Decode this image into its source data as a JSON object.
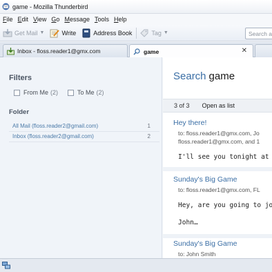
{
  "window": {
    "title": "game - Mozilla Thunderbird"
  },
  "menu": [
    {
      "key": "F",
      "rest": "ile"
    },
    {
      "key": "E",
      "rest": "dit"
    },
    {
      "key": "V",
      "rest": "iew"
    },
    {
      "key": "G",
      "rest": "o"
    },
    {
      "key": "M",
      "rest": "essage"
    },
    {
      "key": "T",
      "rest": "ools"
    },
    {
      "key": "H",
      "rest": "elp"
    }
  ],
  "toolbar": {
    "get_mail": "Get Mail",
    "write": "Write",
    "address_book": "Address Book",
    "tag": "Tag",
    "search_placeholder": "Search al"
  },
  "tabs": {
    "inbox": "Inbox - floss.reader1@gmx.com",
    "search": "game"
  },
  "filters": {
    "heading": "Filters",
    "from_me": {
      "label": "From Me",
      "count": "(2)"
    },
    "to_me": {
      "label": "To Me",
      "count": "(2)"
    }
  },
  "folders": {
    "heading": "Folder",
    "items": [
      {
        "label": "All Mail (floss.reader2@gmail.com)",
        "count": "1"
      },
      {
        "label": "Inbox (floss.reader2@gmail.com)",
        "count": "2"
      }
    ]
  },
  "results": {
    "title_label": "Search",
    "title_term": "game",
    "count": "3 of 3",
    "open_as_list": "Open as list",
    "messages": [
      {
        "subject": "Hey there!",
        "to_line": "to: floss.reader1@gmx.com, Jo",
        "to_line2": "floss.reader1@gmx.com, and 1",
        "body": "I'll see you tonight at"
      },
      {
        "subject": "Sunday's Big Game",
        "to_line": "to: floss.reader1@gmx.com, FL",
        "body": "Hey, are you going to jo",
        "body2": "John…"
      },
      {
        "subject": "Sunday's Big Game",
        "to_line": "to: John Smith"
      }
    ]
  }
}
